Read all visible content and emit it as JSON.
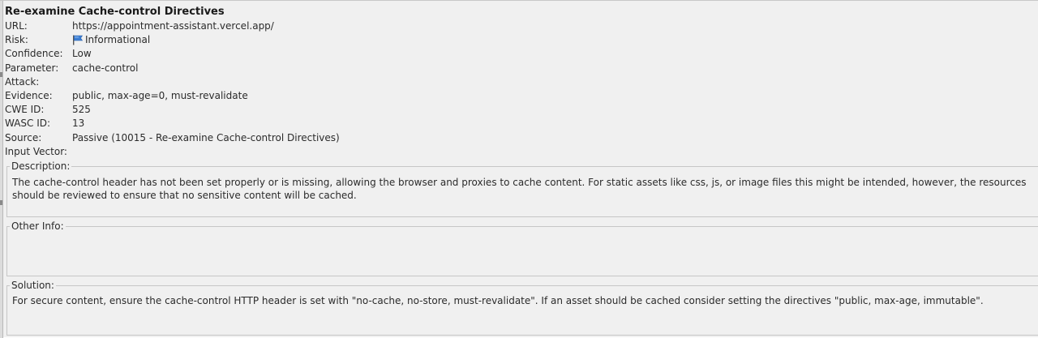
{
  "alert": {
    "title": "Re-examine Cache-control Directives"
  },
  "fields": {
    "url": {
      "label": "URL:",
      "value": "https://appointment-assistant.vercel.app/"
    },
    "risk": {
      "label": "Risk:",
      "value": "Informational",
      "icon": "blue-flag-icon"
    },
    "confidence": {
      "label": "Confidence:",
      "value": "Low"
    },
    "parameter": {
      "label": "Parameter:",
      "value": "cache-control"
    },
    "attack": {
      "label": "Attack:",
      "value": ""
    },
    "evidence": {
      "label": "Evidence:",
      "value": "public, max-age=0, must-revalidate"
    },
    "cwe": {
      "label": "CWE ID:",
      "value": "525"
    },
    "wasc": {
      "label": "WASC ID:",
      "value": "13"
    },
    "source": {
      "label": "Source:",
      "value": "Passive (10015 - Re-examine Cache-control Directives)"
    },
    "input_vector": {
      "label": "Input Vector:",
      "value": ""
    }
  },
  "description": {
    "label": "Description:",
    "text": "The cache-control header has not been set properly or is missing, allowing the browser and proxies to cache content. For static assets like css, js, or image files this might be intended, however, the resources should be reviewed to ensure that no sensitive content will be cached."
  },
  "other_info": {
    "label": "Other Info:",
    "text": ""
  },
  "solution": {
    "label": "Solution:",
    "text": "For secure content, ensure the cache-control HTTP header is set with \"no-cache, no-store, must-revalidate\". If an asset should be cached consider setting the directives \"public, max-age, immutable\"."
  },
  "colors": {
    "panel_background": "#f0f0f0",
    "border": "#c6c6c6",
    "flag_blue": "#3d7fd4"
  }
}
